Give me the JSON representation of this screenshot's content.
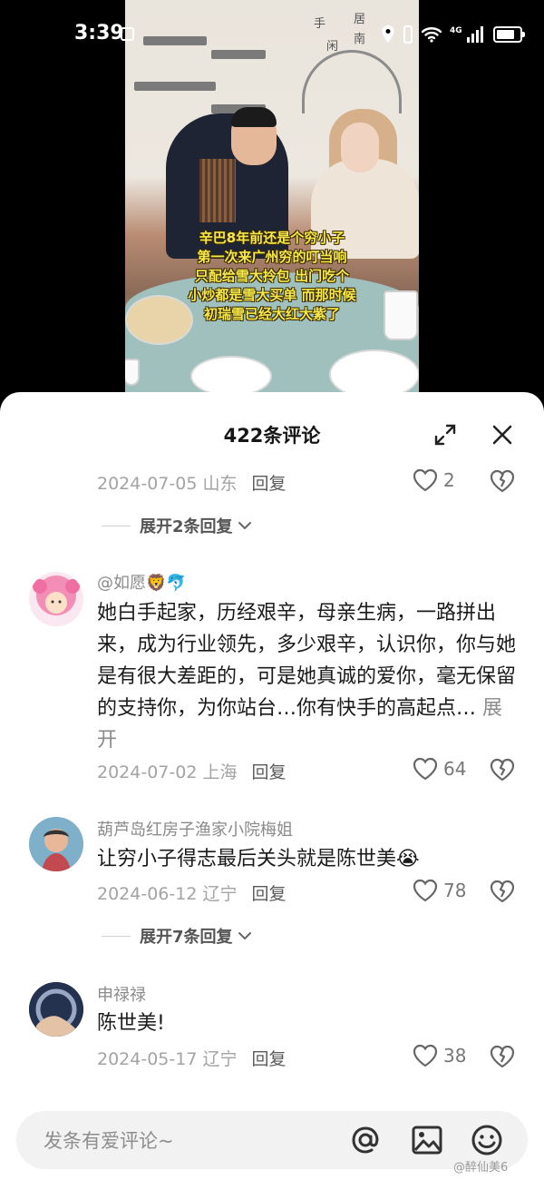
{
  "status_bar": {
    "time": "3:39",
    "network": "4G",
    "battery_level": 0.8
  },
  "video": {
    "mural_text": [
      "手",
      "闲",
      "居",
      "南"
    ],
    "subtitles": [
      "辛巴8年前还是个穷小子",
      "第一次来广州穷的叮当响",
      "只配给雪大拎包 出门吃个",
      "小炒都是雪大买单 而那时候",
      "初瑞雪已经大红大紫了"
    ]
  },
  "comments_panel": {
    "title": "422条评论",
    "comments": [
      {
        "date": "2024-07-05",
        "location": "山东",
        "reply_label": "回复",
        "likes": "2",
        "expand_replies": "展开2条回复"
      },
      {
        "username": "@如愿🦁🐬",
        "text": "她白手起家，历经艰辛，母亲生病，一路拼出来，成为行业领先，多少艰辛，认识你，你与她是有很大差距的，可是她真诚的爱你，毫无保留的支持你，为你站台…你有快手的高起点…",
        "expand_text": "展开",
        "date": "2024-07-02",
        "location": "上海",
        "reply_label": "回复",
        "likes": "64"
      },
      {
        "username": "葫芦岛红房子渔家小院梅姐",
        "text": "让穷小子得志最后关头就是陈世美😭",
        "date": "2024-06-12",
        "location": "辽宁",
        "reply_label": "回复",
        "likes": "78",
        "expand_replies": "展开7条回复"
      },
      {
        "username": "申禄禄",
        "text": "陈世美!",
        "date": "2024-05-17",
        "location": "辽宁",
        "reply_label": "回复",
        "likes": "38"
      }
    ]
  },
  "input_bar": {
    "placeholder": "发条有爱评论~"
  },
  "watermark": "@醉仙美6",
  "colors": {
    "subtitle": "#f5e84a",
    "sheet_bg": "#ffffff",
    "muted_text": "#a3a3a3"
  },
  "icons": [
    "expand-icon",
    "close-icon",
    "heart-icon",
    "dislike-heart-icon",
    "at-icon",
    "image-icon",
    "emoji-icon"
  ]
}
